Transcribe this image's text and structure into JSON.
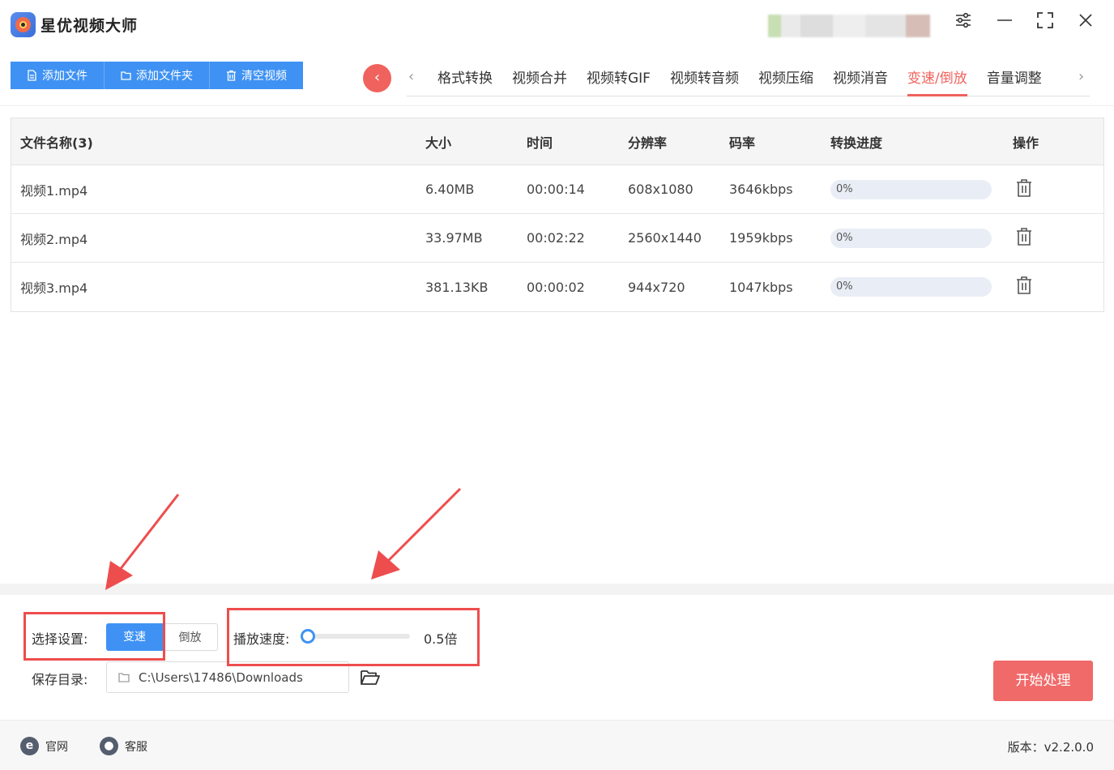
{
  "app": {
    "title": "星优视频大师"
  },
  "toolbar": {
    "add_file": "添加文件",
    "add_folder": "添加文件夹",
    "clear_videos": "清空视频"
  },
  "nav": {
    "tabs": [
      "格式转换",
      "视频合并",
      "视频转GIF",
      "视频转音频",
      "视频压缩",
      "视频消音",
      "变速/倒放",
      "音量调整"
    ],
    "active_index": 6
  },
  "table": {
    "headers": {
      "name": "文件名称(3)",
      "size": "大小",
      "time": "时间",
      "resolution": "分辨率",
      "bitrate": "码率",
      "progress": "转换进度",
      "action": "操作"
    },
    "rows": [
      {
        "name": "视频1.mp4",
        "size": "6.40MB",
        "time": "00:00:14",
        "resolution": "608x1080",
        "bitrate": "3646kbps",
        "progress": "0%",
        "progress_value": 0
      },
      {
        "name": "视频2.mp4",
        "size": "33.97MB",
        "time": "00:02:22",
        "resolution": "2560x1440",
        "bitrate": "1959kbps",
        "progress": "0%",
        "progress_value": 0
      },
      {
        "name": "视频3.mp4",
        "size": "381.13KB",
        "time": "00:00:02",
        "resolution": "944x720",
        "bitrate": "1047kbps",
        "progress": "0%",
        "progress_value": 0
      }
    ]
  },
  "settings": {
    "select_label": "选择设置:",
    "mode_speed": "变速",
    "mode_reverse": "倒放",
    "active_mode": "变速",
    "speed_label": "播放速度:",
    "speed_value": "0.5倍",
    "speed_fraction": 0,
    "save_label": "保存目录:",
    "save_path": "C:\\Users\\17486\\Downloads",
    "start_button": "开始处理"
  },
  "footer": {
    "website": "官网",
    "support": "客服",
    "version": "版本：v2.2.0.0"
  },
  "colors": {
    "primary": "#3f92f3",
    "accent": "#f0625d",
    "start_button": "#f06a6a",
    "annotation": "#ee4d4d"
  }
}
